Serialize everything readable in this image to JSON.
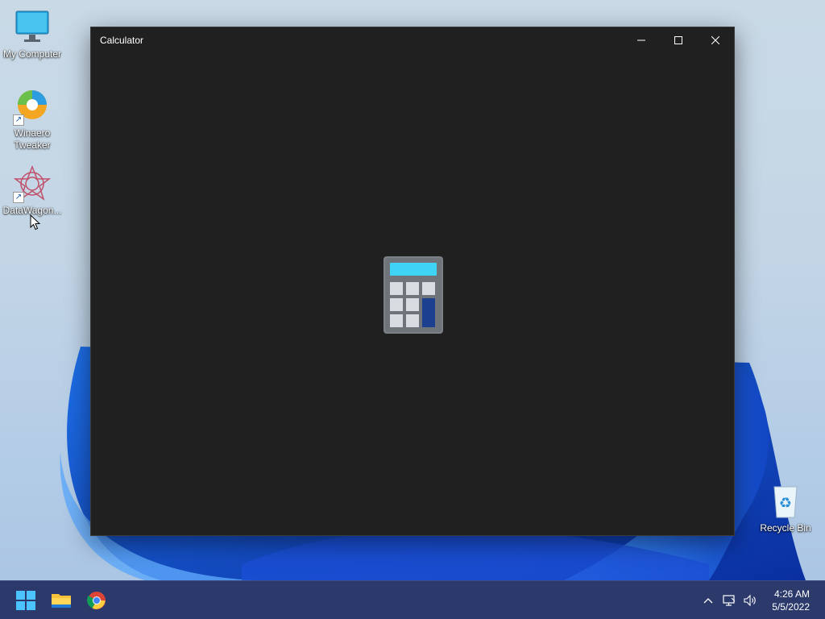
{
  "desktop": {
    "icons": [
      {
        "label": "My Computer"
      },
      {
        "label": "Winaero Tweaker"
      },
      {
        "label": "DataWagon..."
      },
      {
        "label": "Recycle Bin"
      }
    ]
  },
  "window": {
    "title": "Calculator",
    "controls": {
      "minimize": "minimize-icon",
      "maximize": "maximize-icon",
      "close": "close-icon"
    },
    "splash_icon": "calculator-icon"
  },
  "taskbar": {
    "apps": [
      {
        "icon": "start-icon"
      },
      {
        "icon": "file-explorer-icon"
      },
      {
        "icon": "chrome-icon"
      }
    ],
    "tray": {
      "time": "4:26 AM",
      "date": "5/5/2022"
    }
  },
  "colors": {
    "window_bg": "#202020",
    "taskbar_bg": "#2b3a6b",
    "accent": "#0078d4"
  }
}
